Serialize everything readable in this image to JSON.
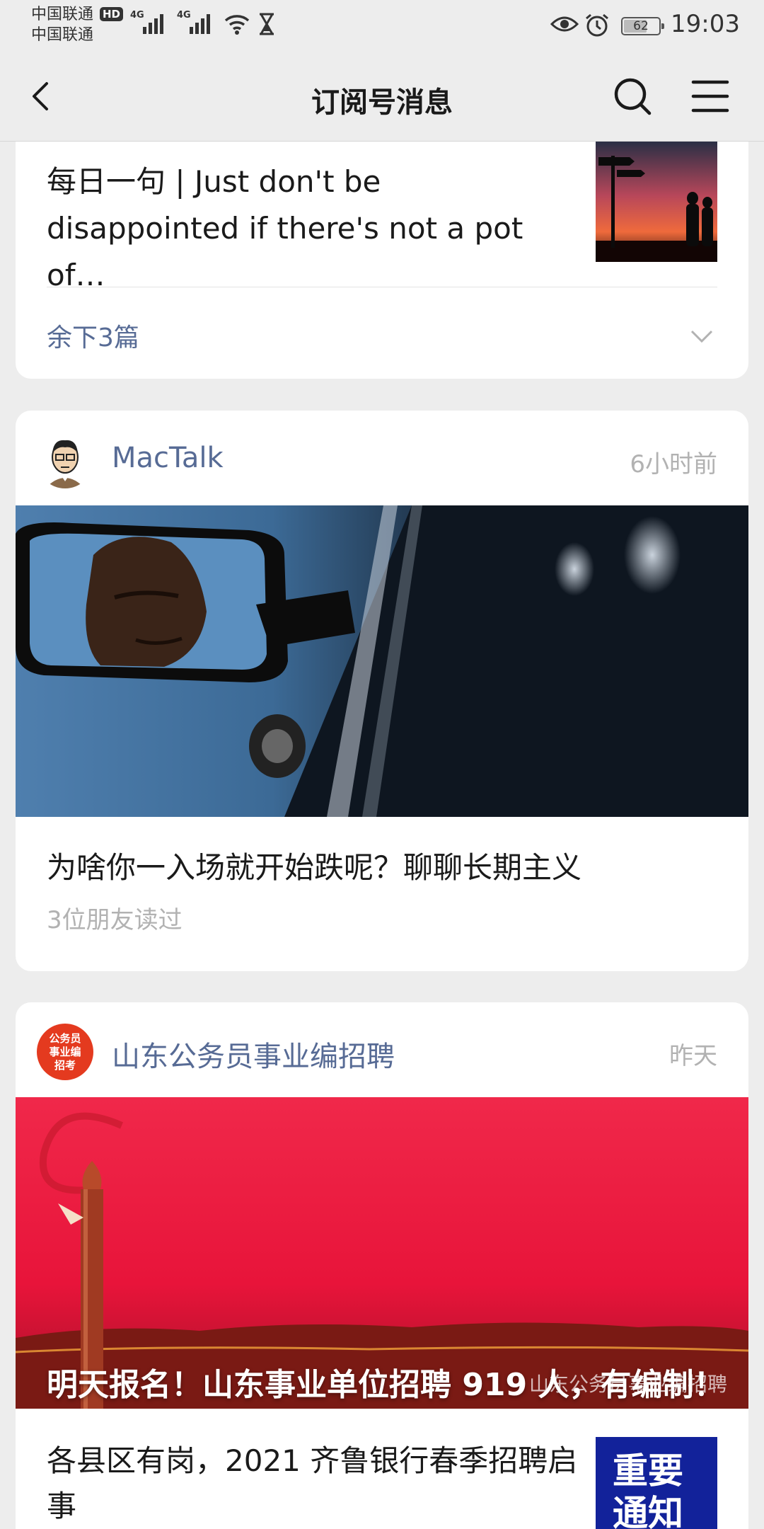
{
  "status_bar": {
    "carrier_1": "中国联通",
    "carrier_2": "中国联通",
    "hd": "HD",
    "net_1": "4G",
    "net_2": "4G",
    "battery": "62",
    "time": "19:03"
  },
  "nav": {
    "title": "订阅号消息"
  },
  "cards": [
    {
      "article_title": "每日一句 | Just don't be disappointed if there's not a pot of…",
      "more_label": "余下3篇"
    },
    {
      "account": "MacTalk",
      "time": "6小时前",
      "article_title": "为啥你一入场就开始跌呢？聊聊长期主义",
      "readers": "3位朋友读过"
    },
    {
      "account": "山东公务员事业编招聘",
      "avatar_text": "公务员事业编招考",
      "time": "昨天",
      "hero_title": "明天报名！山东事业单位招聘 919 人，有编制！",
      "watermark": "山东公务员事业编招聘",
      "sub_title": "各县区有岗，2021 齐鲁银行春季招聘启事",
      "sub_thumb_text": "重要通知"
    }
  ],
  "colors": {
    "background": "#ededed",
    "card": "#ffffff",
    "link_blue": "#576b95",
    "muted": "#b2b2b2"
  },
  "icons": [
    "back-arrow-icon",
    "search-icon",
    "menu-icon",
    "chevron-down-icon",
    "wifi-icon",
    "eye-icon",
    "alarm-icon",
    "hourglass-icon"
  ]
}
